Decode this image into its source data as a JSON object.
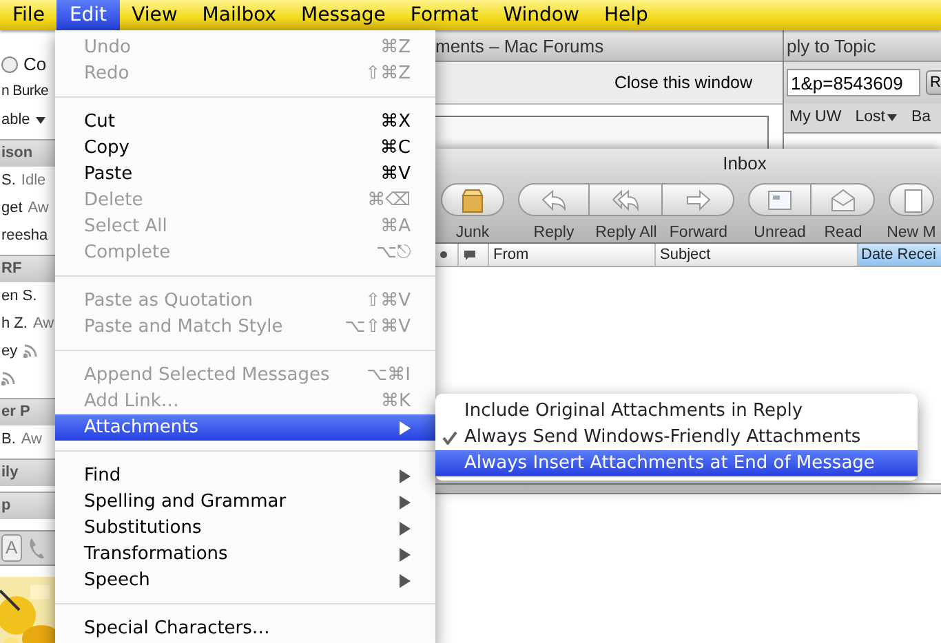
{
  "menubar": {
    "items": [
      {
        "label": "File",
        "selected": false
      },
      {
        "label": "Edit",
        "selected": true
      },
      {
        "label": "View",
        "selected": false
      },
      {
        "label": "Mailbox",
        "selected": false
      },
      {
        "label": "Message",
        "selected": false
      },
      {
        "label": "Format",
        "selected": false
      },
      {
        "label": "Window",
        "selected": false
      },
      {
        "label": "Help",
        "selected": false
      }
    ]
  },
  "buddy_list": {
    "items": [
      {
        "kind": "status",
        "label": "Co"
      },
      {
        "kind": "name",
        "label": "n Burke"
      },
      {
        "kind": "availability",
        "label": "able"
      },
      {
        "kind": "header",
        "label": "ison"
      },
      {
        "kind": "buddy",
        "label": "S.",
        "status": "Idle"
      },
      {
        "kind": "buddy",
        "label": "get",
        "status": "Aw"
      },
      {
        "kind": "buddy",
        "label": "reesha"
      },
      {
        "kind": "header",
        "label": "RF"
      },
      {
        "kind": "buddy",
        "label": "en S."
      },
      {
        "kind": "buddy",
        "label": "h Z.",
        "status": "Aw"
      },
      {
        "kind": "feed",
        "label": "ey"
      },
      {
        "kind": "feed"
      },
      {
        "kind": "header",
        "label": "er P"
      },
      {
        "kind": "buddy",
        "label": "B.",
        "status": "Aw"
      },
      {
        "kind": "header",
        "label": "ily"
      },
      {
        "kind": "header",
        "label": "p"
      }
    ],
    "toolbar_button": "A"
  },
  "forums_window": {
    "title": "ments – Mac Forums",
    "close_link": "Close this window"
  },
  "browser_window": {
    "title": "ply to Topic",
    "address": "1&p=8543609",
    "go_button": "R",
    "bookmarks": [
      {
        "label": "My UW",
        "menu": false
      },
      {
        "label": "Lost",
        "menu": true
      },
      {
        "label": "Ba",
        "menu": false
      }
    ]
  },
  "inbox_window": {
    "title": "Inbox",
    "toolbar": [
      {
        "buttons": [
          {
            "kind": "junk",
            "label": "Junk"
          }
        ]
      },
      {
        "buttons": [
          {
            "kind": "reply",
            "label": "Reply"
          },
          {
            "kind": "reply-all",
            "label": "Reply All"
          },
          {
            "kind": "forward",
            "label": "Forward"
          }
        ]
      },
      {
        "buttons": [
          {
            "kind": "unread",
            "label": "Unread"
          },
          {
            "kind": "read",
            "label": "Read"
          }
        ]
      },
      {
        "buttons": [
          {
            "kind": "new",
            "label": "New M"
          }
        ]
      }
    ],
    "columns": [
      {
        "kind": "dot",
        "selected": false
      },
      {
        "kind": "bubble",
        "selected": false
      },
      {
        "kind": "text",
        "label": "From",
        "selected": false
      },
      {
        "kind": "text",
        "label": "Subject",
        "selected": false
      },
      {
        "kind": "text",
        "label": "Date Recei",
        "selected": true
      }
    ]
  },
  "edit_menu": {
    "items": [
      {
        "kind": "item",
        "label": "Undo",
        "shortcut": "⌘Z",
        "disabled": true,
        "selected": false
      },
      {
        "kind": "item",
        "label": "Redo",
        "shortcut": "⇧⌘Z",
        "disabled": true,
        "selected": false
      },
      {
        "kind": "separator"
      },
      {
        "kind": "item",
        "label": "Cut",
        "shortcut": "⌘X",
        "disabled": false,
        "selected": false
      },
      {
        "kind": "item",
        "label": "Copy",
        "shortcut": "⌘C",
        "disabled": false,
        "selected": false
      },
      {
        "kind": "item",
        "label": "Paste",
        "shortcut": "⌘V",
        "disabled": false,
        "selected": false
      },
      {
        "kind": "item",
        "label": "Delete",
        "shortcut": "⌘⌫",
        "disabled": true,
        "selected": false
      },
      {
        "kind": "item",
        "label": "Select All",
        "shortcut": "⌘A",
        "disabled": true,
        "selected": false
      },
      {
        "kind": "item",
        "label": "Complete",
        "shortcut": "⌥⎋",
        "disabled": true,
        "selected": false
      },
      {
        "kind": "separator"
      },
      {
        "kind": "item",
        "label": "Paste as Quotation",
        "shortcut": "⇧⌘V",
        "disabled": true,
        "selected": false
      },
      {
        "kind": "item",
        "label": "Paste and Match Style",
        "shortcut": "⌥⇧⌘V",
        "disabled": true,
        "selected": false
      },
      {
        "kind": "separator"
      },
      {
        "kind": "item",
        "label": "Append Selected Messages",
        "shortcut": "⌥⌘I",
        "disabled": true,
        "selected": false
      },
      {
        "kind": "item",
        "label": "Add Link…",
        "shortcut": "⌘K",
        "disabled": true,
        "selected": false
      },
      {
        "kind": "submenu",
        "label": "Attachments",
        "disabled": false,
        "selected": true
      },
      {
        "kind": "separator"
      },
      {
        "kind": "submenu",
        "label": "Find",
        "disabled": false,
        "selected": false
      },
      {
        "kind": "submenu",
        "label": "Spelling and Grammar",
        "disabled": false,
        "selected": false
      },
      {
        "kind": "submenu",
        "label": "Substitutions",
        "disabled": false,
        "selected": false
      },
      {
        "kind": "submenu",
        "label": "Transformations",
        "disabled": false,
        "selected": false
      },
      {
        "kind": "submenu",
        "label": "Speech",
        "disabled": false,
        "selected": false
      },
      {
        "kind": "separator"
      },
      {
        "kind": "item",
        "label": "Special Characters…",
        "disabled": false,
        "selected": false
      }
    ]
  },
  "attachments_submenu": {
    "items": [
      {
        "label": "Include Original Attachments in Reply",
        "checked": false,
        "selected": false
      },
      {
        "label": "Always Send Windows-Friendly Attachments",
        "checked": true,
        "selected": false
      },
      {
        "label": "Always Insert Attachments at End of Message",
        "checked": false,
        "selected": true
      }
    ]
  }
}
